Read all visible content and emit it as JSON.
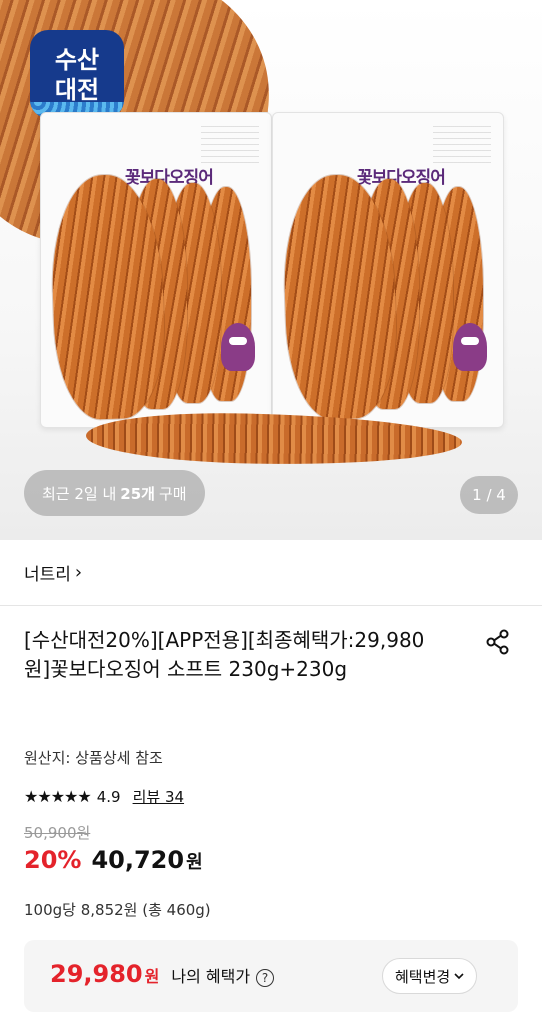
{
  "hero": {
    "brand_logo_line1": "수산",
    "brand_logo_line2": "대전",
    "pack_label": "꽃보다오징어",
    "recent_purchase": {
      "prefix": "최근 2일 내",
      "count": "25개",
      "suffix": "구매"
    },
    "page_indicator": "1 / 4"
  },
  "seller": {
    "name": "너트리",
    "chevron": "›"
  },
  "product": {
    "title": "[수산대전20%][APP전용][최종혜택가:29,980원]꽃보다오징어 소프트 230g+230g",
    "origin": "원산지: 상품상세 참조",
    "rating": {
      "stars": "★★★★★",
      "score": "4.9",
      "review_label": "리뷰 34"
    },
    "original_price": "50,900원",
    "discount_rate": "20%",
    "sale_price": "40,720",
    "sale_price_unit": "원",
    "unit_price": "100g당 8,852원 (총 460g)"
  },
  "benefit": {
    "price": "29,980",
    "price_unit": "원",
    "label": "나의 혜택가",
    "help_glyph": "?",
    "change_button": "혜택변경",
    "change_button_icon": "chevron-down-icon"
  },
  "icons": {
    "share": "share-icon"
  },
  "colors": {
    "accent_red": "#e4232b",
    "logo_blue": "#163a8c"
  }
}
